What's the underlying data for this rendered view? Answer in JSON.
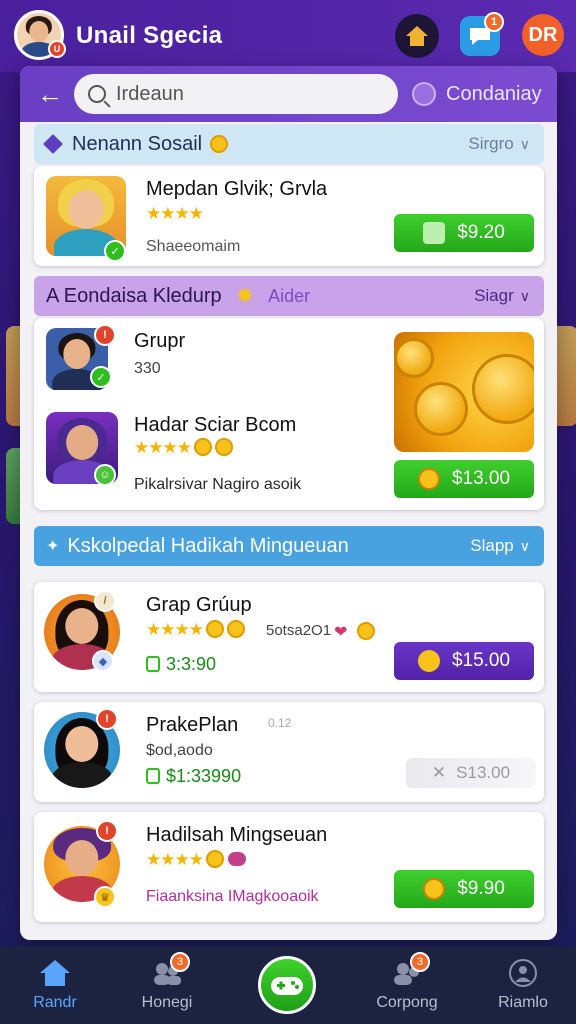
{
  "header": {
    "title": "Unail Sgecia",
    "avatar_badge": "U",
    "right_button_label": "DR",
    "chat_badge": "1"
  },
  "search": {
    "value": "Irdeaun",
    "condition_label": "Condaniay"
  },
  "sections": [
    {
      "title": "Nenann Sosail",
      "more_label": "Sirgro",
      "items": [
        {
          "title": "Mepdan Glvik; Grvla",
          "sub": "Shaeeomaim",
          "price": "$9.20"
        }
      ]
    },
    {
      "title": "A Eondaisa Kledurp",
      "tag": "Aider",
      "more_label": "Siagr",
      "items": [
        {
          "title": "Grupr",
          "sub": "330"
        },
        {
          "title": "Hadar Sciar Bcom",
          "sub": "Pikalrsivar Nagiro asoik"
        }
      ],
      "price": "$13.00"
    },
    {
      "title": "Kskolpedal Hadikah Mingueuan",
      "more_label": "Slapp",
      "items": [
        {
          "title": "Grap Grúup",
          "meta": "5otsa2O1",
          "sub": "3:3:90",
          "price": "$15.00"
        },
        {
          "title": "PrakePlan",
          "meta": "0.12",
          "sub_top": "$od,aodo",
          "sub": "$1:33990",
          "price": "S13.00"
        },
        {
          "title": "Hadilsah Mingseuan",
          "sub": "Fiaanksina IMagkooaoik",
          "price": "$9.90"
        }
      ]
    }
  ],
  "nav": {
    "items": [
      "Randr",
      "Honegi",
      "Corpong",
      "Riamlo"
    ],
    "badges": [
      "3",
      "3"
    ]
  },
  "colors": {
    "brand_purple": "#5a2ab0",
    "green": "#2fbd20",
    "nav_active": "#5aa6ff"
  }
}
